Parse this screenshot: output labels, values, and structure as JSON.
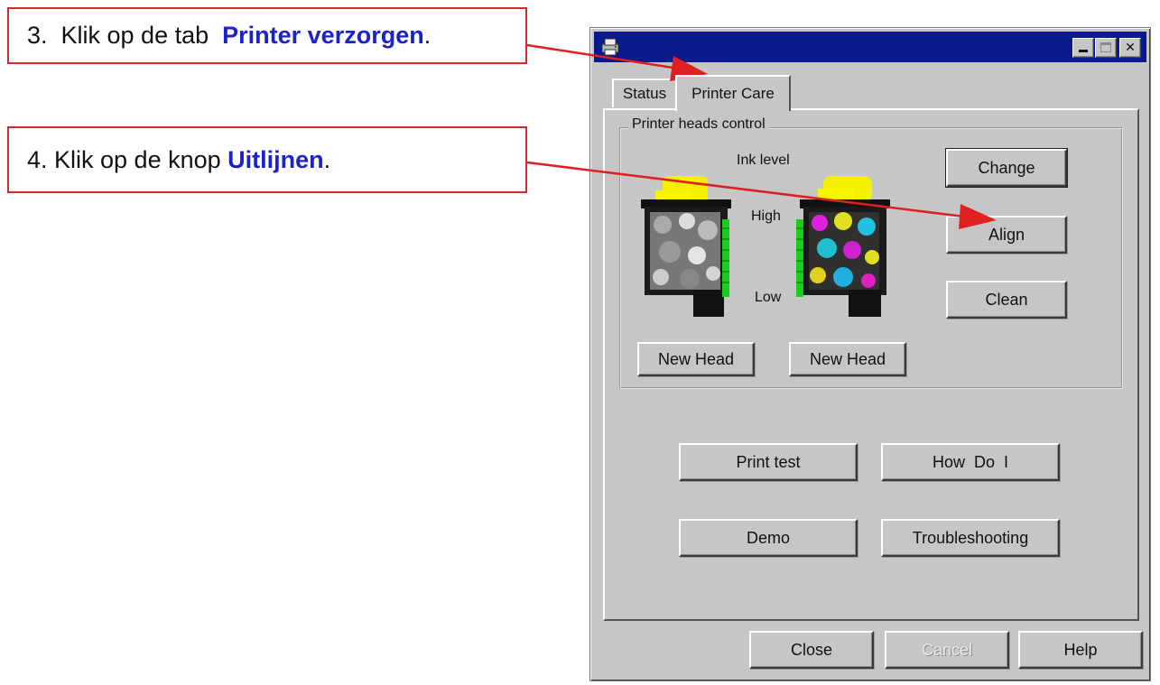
{
  "callouts": {
    "step3": {
      "prefix": "3.  Klik op de tab  ",
      "highlight": "Printer verzorgen",
      "suffix": "."
    },
    "step4": {
      "prefix": "4. Klik op de knop ",
      "highlight": "Uitlijnen",
      "suffix": "."
    }
  },
  "colors": {
    "callout_border": "#d42a2a",
    "highlight": "#1a22c8",
    "arrow": "#e02020",
    "titlebar": "#0a1a8a",
    "dialog": "#c6c6c6"
  },
  "icons": {
    "app": "printer-icon",
    "minimize": "minimize-icon",
    "maximize": "maximize-icon",
    "close": "close-icon"
  },
  "window": {
    "tabs": [
      "Status",
      "Printer Care"
    ],
    "active_tab": "Printer Care",
    "group_label": "Printer heads control",
    "ink_level_label": "Ink level",
    "high_label": "High",
    "low_label": "Low",
    "buttons": {
      "change": "Change",
      "align": "Align",
      "clean": "Clean",
      "new_head_left": "New Head",
      "new_head_right": "New Head",
      "print_test": "Print test",
      "how_do_i": "How  Do  I",
      "demo": "Demo",
      "troubleshooting": "Troubleshooting",
      "close": "Close",
      "cancel": "Cancel",
      "help": "Help"
    },
    "cartridges": [
      "black",
      "color"
    ]
  }
}
